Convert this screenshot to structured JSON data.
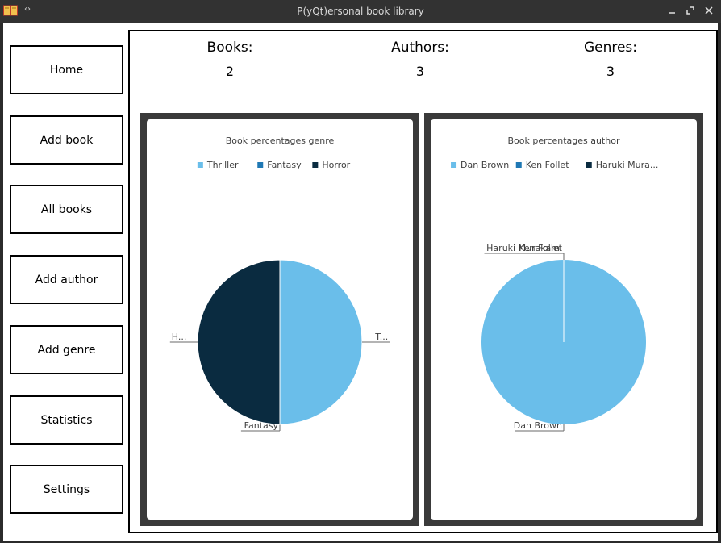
{
  "window": {
    "title": "P(yQt)ersonal book library",
    "icons": {
      "app": "book-icon",
      "nav": "arrows-icon",
      "minimize": "minimize-icon",
      "maximize": "maximize-icon",
      "close": "close-icon"
    }
  },
  "sidebar": {
    "items": [
      {
        "label": "Home"
      },
      {
        "label": "Add book"
      },
      {
        "label": "All books"
      },
      {
        "label": "Add author"
      },
      {
        "label": "Add genre"
      },
      {
        "label": "Statistics"
      },
      {
        "label": "Settings"
      }
    ]
  },
  "stats": {
    "books": {
      "label": "Books:",
      "value": "2"
    },
    "authors": {
      "label": "Authors:",
      "value": "3"
    },
    "genres": {
      "label": "Genres:",
      "value": "3"
    }
  },
  "colors": {
    "light_blue": "#6ABEEA",
    "mid_blue": "#1F78B4",
    "dark_navy": "#0A2B40",
    "frame": "#3A3A3A"
  },
  "chart_data": [
    {
      "type": "pie",
      "title": "Book percentages genre",
      "legend_position": "top",
      "categories": [
        "Thriller",
        "Fantasy",
        "Horror"
      ],
      "values": [
        1,
        0,
        1
      ],
      "slice_labels": [
        "T...",
        "Fantasy",
        "H..."
      ],
      "colors": [
        "#6ABEEA",
        "#1F78B4",
        "#0A2B40"
      ]
    },
    {
      "type": "pie",
      "title": "Book percentages author",
      "legend_position": "top",
      "categories": [
        "Dan Brown",
        "Ken Follet",
        "Haruki Mura..."
      ],
      "values": [
        2,
        0,
        0
      ],
      "slice_labels": [
        "Dan Brown",
        "Ken Follet",
        "Haruki Murakami"
      ],
      "colors": [
        "#6ABEEA",
        "#1F78B4",
        "#0A2B40"
      ]
    }
  ]
}
